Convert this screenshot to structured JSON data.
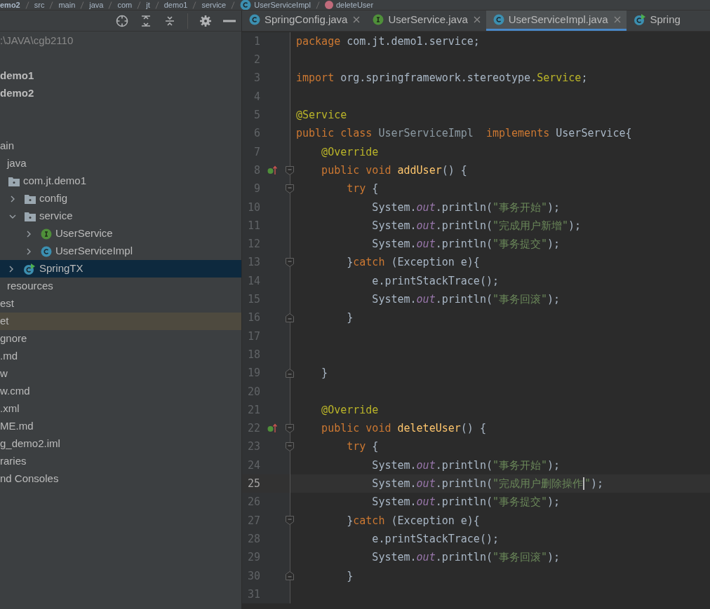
{
  "breadcrumbs": [
    {
      "label": "emo2",
      "kind": "module"
    },
    {
      "label": "src",
      "kind": "folder"
    },
    {
      "label": "main",
      "kind": "folder"
    },
    {
      "label": "java",
      "kind": "folder"
    },
    {
      "label": "com",
      "kind": "folder"
    },
    {
      "label": "jt",
      "kind": "folder"
    },
    {
      "label": "demo1",
      "kind": "folder"
    },
    {
      "label": "service",
      "kind": "folder"
    },
    {
      "label": "UserServiceImpl",
      "kind": "class"
    },
    {
      "label": "deleteUser",
      "kind": "method"
    }
  ],
  "project": {
    "path": ":\\JAVA\\cgb2110",
    "modules": [
      "demo1",
      "demo2"
    ],
    "tree": [
      {
        "label": "ain",
        "selected": false,
        "highlighted": false,
        "children": [
          {
            "label": "java",
            "selected": false,
            "highlighted": false,
            "children": [
              {
                "label": "com.jt.demo1",
                "kind": "package",
                "selected": false,
                "highlighted": false,
                "children": [
                  {
                    "label": "config",
                    "kind": "package",
                    "selected": false,
                    "highlighted": false,
                    "expanded": false
                  },
                  {
                    "label": "service",
                    "kind": "package",
                    "selected": false,
                    "highlighted": false,
                    "expanded": true,
                    "children": [
                      {
                        "label": "UserService",
                        "kind": "interface",
                        "selected": false,
                        "highlighted": false,
                        "expanded": false
                      },
                      {
                        "label": "UserServiceImpl",
                        "kind": "class",
                        "selected": false,
                        "highlighted": false,
                        "expanded": false
                      }
                    ]
                  },
                  {
                    "label": "SpringTX",
                    "kind": "runnable",
                    "selected": true,
                    "highlighted": false,
                    "expanded": false
                  }
                ]
              }
            ]
          },
          {
            "label": "resources",
            "selected": false,
            "highlighted": false
          }
        ]
      },
      {
        "label": "est",
        "selected": false,
        "highlighted": false
      },
      {
        "label": "et",
        "selected": false,
        "highlighted": true
      },
      {
        "label": "gnore",
        "selected": false,
        "highlighted": false
      },
      {
        "label": ".md",
        "selected": false,
        "highlighted": false
      },
      {
        "label": "w",
        "selected": false,
        "highlighted": false
      },
      {
        "label": "w.cmd",
        "selected": false,
        "highlighted": false
      },
      {
        "label": ".xml",
        "selected": false,
        "highlighted": false
      },
      {
        "label": "ME.md",
        "selected": false,
        "highlighted": false
      },
      {
        "label": "g_demo2.iml",
        "selected": false,
        "highlighted": false
      },
      {
        "label": "raries",
        "selected": false,
        "highlighted": false
      },
      {
        "label": "nd Consoles",
        "selected": false,
        "highlighted": false
      }
    ]
  },
  "tabs": [
    {
      "label": "SpringConfig.java",
      "kind": "class",
      "selected": false,
      "closable": true
    },
    {
      "label": "UserService.java",
      "kind": "interface",
      "selected": false,
      "closable": true
    },
    {
      "label": "UserServiceImpl.java",
      "kind": "class",
      "selected": true,
      "closable": true
    },
    {
      "label": "Spring",
      "kind": "runnable",
      "selected": false,
      "closable": false
    }
  ],
  "editor": {
    "lines": [
      {
        "number": "1",
        "current": false,
        "tokens": [
          {
            "kind": "kw",
            "text": "package"
          },
          {
            "kind": "plain",
            "text": " com.jt.demo1.service;"
          }
        ]
      },
      {
        "number": "2",
        "current": false
      },
      {
        "number": "3",
        "current": false,
        "tokens": [
          {
            "kind": "kw",
            "text": "import"
          },
          {
            "kind": "plain",
            "text": " org.springframework.stereotype."
          },
          {
            "kind": "ann",
            "text": "Service"
          },
          {
            "kind": "plain",
            "text": ";"
          }
        ]
      },
      {
        "number": "4",
        "current": false
      },
      {
        "number": "5",
        "current": false,
        "tokens": [
          {
            "kind": "ann",
            "text": "@Service"
          }
        ]
      },
      {
        "number": "6",
        "current": false,
        "tokens": [
          {
            "kind": "kw",
            "text": "public class "
          },
          {
            "kind": "dim",
            "text": "UserServiceImpl"
          },
          {
            "kind": "kw",
            "text": "  implements "
          },
          {
            "kind": "plain",
            "text": "UserService{"
          }
        ]
      },
      {
        "number": "7",
        "current": false,
        "tokens": [
          {
            "kind": "ann",
            "text": "    @Override"
          }
        ]
      },
      {
        "number": "8",
        "current": false,
        "gutter_icons": [
          {
            "kind": "implements"
          },
          {
            "kind": "fold-start"
          }
        ],
        "tokens": [
          {
            "kind": "kw",
            "text": "    public void "
          },
          {
            "kind": "fn",
            "text": "addUser"
          },
          {
            "kind": "plain",
            "text": "() {"
          }
        ]
      },
      {
        "number": "9",
        "current": false,
        "gutter_icons": [
          {
            "kind": "fold-start"
          }
        ],
        "tokens": [
          {
            "kind": "kw",
            "text": "        try"
          },
          {
            "kind": "plain",
            "text": " {"
          }
        ]
      },
      {
        "number": "10",
        "current": false,
        "tokens": [
          {
            "kind": "plain",
            "text": "            System."
          },
          {
            "kind": "field",
            "text": "out"
          },
          {
            "kind": "plain",
            "text": ".println("
          },
          {
            "kind": "str",
            "text": "\"事务开始\""
          },
          {
            "kind": "plain",
            "text": ");"
          }
        ]
      },
      {
        "number": "11",
        "current": false,
        "tokens": [
          {
            "kind": "plain",
            "text": "            System."
          },
          {
            "kind": "field",
            "text": "out"
          },
          {
            "kind": "plain",
            "text": ".println("
          },
          {
            "kind": "str",
            "text": "\"完成用户新增\""
          },
          {
            "kind": "plain",
            "text": ");"
          }
        ]
      },
      {
        "number": "12",
        "current": false,
        "tokens": [
          {
            "kind": "plain",
            "text": "            System."
          },
          {
            "kind": "field",
            "text": "out"
          },
          {
            "kind": "plain",
            "text": ".println("
          },
          {
            "kind": "str",
            "text": "\"事务提交\""
          },
          {
            "kind": "plain",
            "text": ");"
          }
        ]
      },
      {
        "number": "13",
        "current": false,
        "gutter_icons": [
          {
            "kind": "fold-start"
          }
        ],
        "tokens": [
          {
            "kind": "plain",
            "text": "        }"
          },
          {
            "kind": "kw",
            "text": "catch"
          },
          {
            "kind": "plain",
            "text": " (Exception e){"
          }
        ]
      },
      {
        "number": "14",
        "current": false,
        "tokens": [
          {
            "kind": "plain",
            "text": "            e.printStackTrace();"
          }
        ]
      },
      {
        "number": "15",
        "current": false,
        "tokens": [
          {
            "kind": "plain",
            "text": "            System."
          },
          {
            "kind": "field",
            "text": "out"
          },
          {
            "kind": "plain",
            "text": ".println("
          },
          {
            "kind": "str",
            "text": "\"事务回滚\""
          },
          {
            "kind": "plain",
            "text": ");"
          }
        ]
      },
      {
        "number": "16",
        "current": false,
        "gutter_icons": [
          {
            "kind": "fold-end"
          }
        ],
        "tokens": [
          {
            "kind": "plain",
            "text": "        }"
          }
        ]
      },
      {
        "number": "17",
        "current": false
      },
      {
        "number": "18",
        "current": false
      },
      {
        "number": "19",
        "current": false,
        "gutter_icons": [
          {
            "kind": "fold-end"
          }
        ],
        "tokens": [
          {
            "kind": "plain",
            "text": "    }"
          }
        ]
      },
      {
        "number": "20",
        "current": false
      },
      {
        "number": "21",
        "current": false,
        "tokens": [
          {
            "kind": "ann",
            "text": "    @Override"
          }
        ]
      },
      {
        "number": "22",
        "current": false,
        "gutter_icons": [
          {
            "kind": "implements"
          },
          {
            "kind": "fold-start"
          }
        ],
        "tokens": [
          {
            "kind": "kw",
            "text": "    public void "
          },
          {
            "kind": "fn",
            "text": "deleteUser"
          },
          {
            "kind": "plain",
            "text": "() {"
          }
        ]
      },
      {
        "number": "23",
        "current": false,
        "gutter_icons": [
          {
            "kind": "fold-start"
          }
        ],
        "tokens": [
          {
            "kind": "kw",
            "text": "        try"
          },
          {
            "kind": "plain",
            "text": " {"
          }
        ]
      },
      {
        "number": "24",
        "current": false,
        "tokens": [
          {
            "kind": "plain",
            "text": "            System."
          },
          {
            "kind": "field",
            "text": "out"
          },
          {
            "kind": "plain",
            "text": ".println("
          },
          {
            "kind": "str",
            "text": "\"事务开始\""
          },
          {
            "kind": "plain",
            "text": ");"
          }
        ]
      },
      {
        "number": "25",
        "current": true,
        "tokens": [
          {
            "kind": "plain",
            "text": "            System."
          },
          {
            "kind": "field",
            "text": "out"
          },
          {
            "kind": "plain",
            "text": ".println("
          },
          {
            "kind": "str",
            "text": "\"完成用户删除操作"
          },
          {
            "kind": "caret"
          },
          {
            "kind": "str",
            "text": "\""
          },
          {
            "kind": "plain",
            "text": ");"
          }
        ]
      },
      {
        "number": "26",
        "current": false,
        "tokens": [
          {
            "kind": "plain",
            "text": "            System."
          },
          {
            "kind": "field",
            "text": "out"
          },
          {
            "kind": "plain",
            "text": ".println("
          },
          {
            "kind": "str",
            "text": "\"事务提交\""
          },
          {
            "kind": "plain",
            "text": ");"
          }
        ]
      },
      {
        "number": "27",
        "current": false,
        "gutter_icons": [
          {
            "kind": "fold-start"
          }
        ],
        "tokens": [
          {
            "kind": "plain",
            "text": "        }"
          },
          {
            "kind": "kw",
            "text": "catch"
          },
          {
            "kind": "plain",
            "text": " (Exception e){"
          }
        ]
      },
      {
        "number": "28",
        "current": false,
        "tokens": [
          {
            "kind": "plain",
            "text": "            e.printStackTrace();"
          }
        ]
      },
      {
        "number": "29",
        "current": false,
        "tokens": [
          {
            "kind": "plain",
            "text": "            System."
          },
          {
            "kind": "field",
            "text": "out"
          },
          {
            "kind": "plain",
            "text": ".println("
          },
          {
            "kind": "str",
            "text": "\"事务回滚\""
          },
          {
            "kind": "plain",
            "text": ");"
          }
        ]
      },
      {
        "number": "30",
        "current": false,
        "gutter_icons": [
          {
            "kind": "fold-end"
          }
        ],
        "tokens": [
          {
            "kind": "plain",
            "text": "        }"
          }
        ]
      },
      {
        "number": "31",
        "current": false
      }
    ]
  }
}
